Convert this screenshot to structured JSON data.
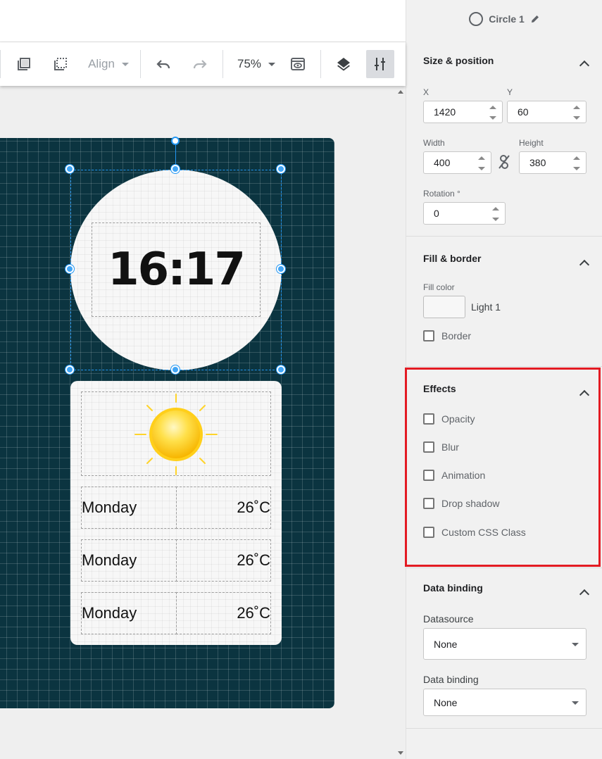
{
  "toolbar": {
    "align_label": "Align",
    "zoom_label": "75%"
  },
  "canvas": {
    "time": "16:17",
    "forecast": [
      {
        "day": "Monday",
        "temp": "26˚C"
      },
      {
        "day": "Monday",
        "temp": "26˚C"
      },
      {
        "day": "Monday",
        "temp": "26˚C"
      }
    ],
    "colors": {
      "background": "#0b3440",
      "selection": "#2196f3",
      "sun": "#ffc107"
    }
  },
  "panel": {
    "element_name": "Circle 1",
    "size_position": {
      "title": "Size & position",
      "x_label": "X",
      "x_value": "1420",
      "y_label": "Y",
      "y_value": "60",
      "width_label": "Width",
      "width_value": "400",
      "height_label": "Height",
      "height_value": "380",
      "rotation_label": "Rotation °",
      "rotation_value": "0"
    },
    "fill_border": {
      "title": "Fill & border",
      "fill_label": "Fill color",
      "fill_name": "Light 1",
      "border_label": "Border"
    },
    "effects": {
      "title": "Effects",
      "options": [
        "Opacity",
        "Blur",
        "Animation",
        "Drop shadow",
        "Custom CSS Class"
      ]
    },
    "data_binding": {
      "title": "Data binding",
      "datasource_label": "Datasource",
      "datasource_value": "None",
      "binding_label": "Data binding",
      "binding_value": "None"
    },
    "highlight_color": "#e31b23"
  }
}
